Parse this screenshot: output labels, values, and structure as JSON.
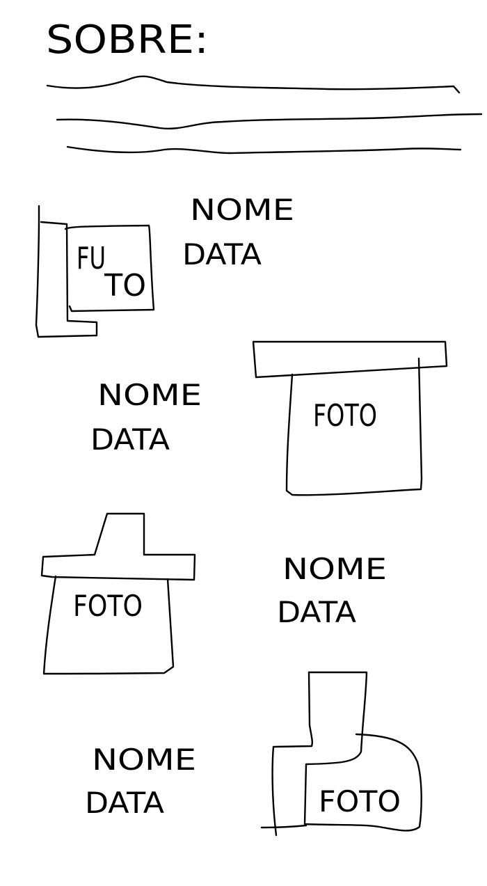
{
  "header": {
    "title": "SOBRE:"
  },
  "entries": [
    {
      "name": "NOME",
      "date": "DATA",
      "photo": "FU TO"
    },
    {
      "name": "NOME",
      "date": "DATA",
      "photo": "FOTO"
    },
    {
      "name": "NOME",
      "date": "DATA",
      "photo": "FOTO"
    },
    {
      "name": "NOME",
      "date": "DATA",
      "photo": "FOTO"
    }
  ],
  "colors": {
    "ink": "#000000",
    "paper": "#ffffff"
  }
}
